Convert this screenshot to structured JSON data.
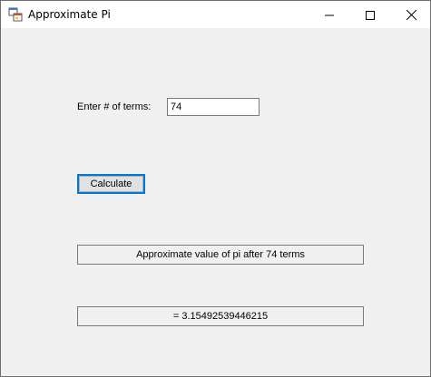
{
  "window": {
    "title": "Approximate Pi",
    "icon": "windows-form-icon",
    "controls": {
      "minimize": "minimize-icon",
      "maximize": "maximize-icon",
      "close": "close-icon"
    }
  },
  "form": {
    "terms_label": "Enter # of terms:",
    "terms_value": "74",
    "calculate_label": "Calculate",
    "description_output": "Approximate value of pi after 74 terms",
    "value_output": "= 3.15492539446215"
  },
  "colors": {
    "client_background": "#f0f0f0",
    "focus_accent": "#0078d7"
  }
}
